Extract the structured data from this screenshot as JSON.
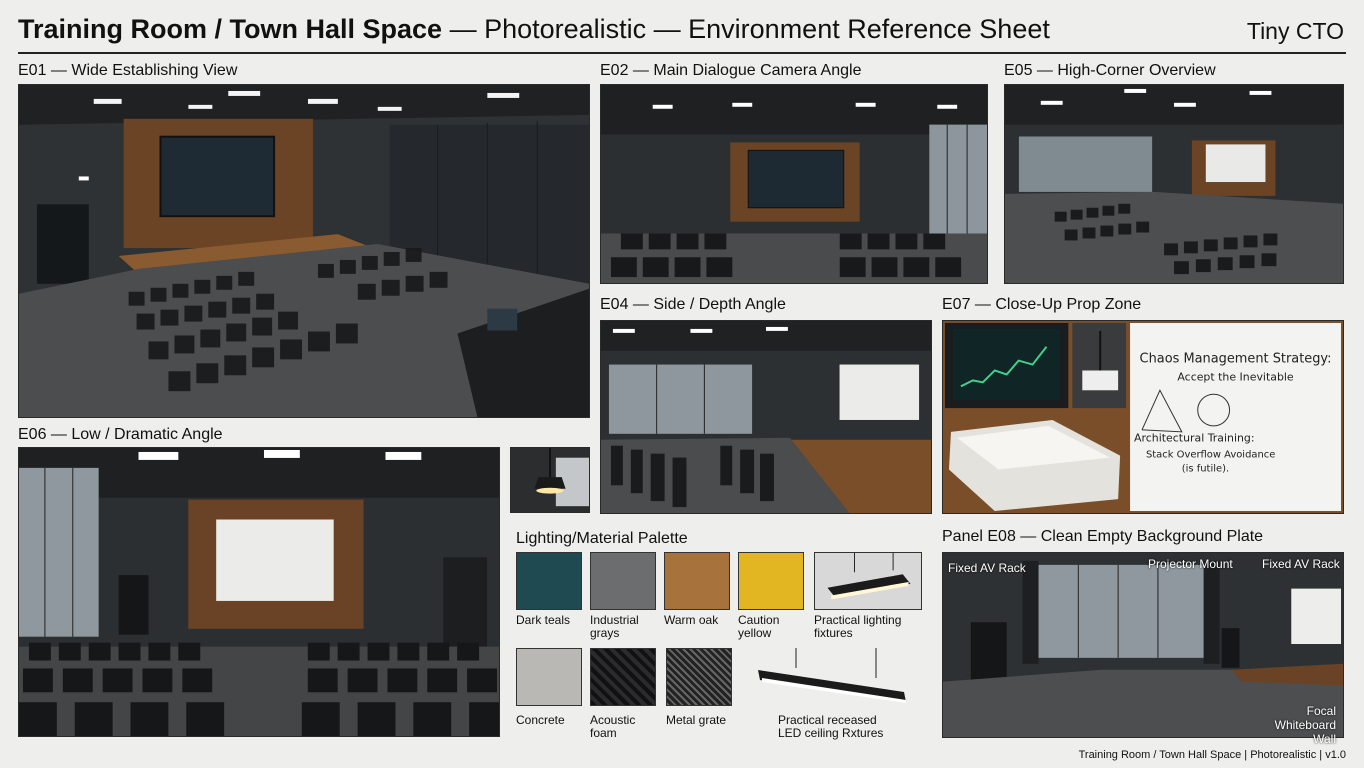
{
  "header": {
    "title_bold": "Training Room / Town Hall Space",
    "title_rest": " — Photorealistic — Environment Reference Sheet",
    "brand": "Tiny CTO"
  },
  "panels": {
    "e01": "E01 — Wide Establishing View",
    "e02": "E02 — Main Dialogue Camera Angle",
    "e05": "E05 — High-Corner Overview",
    "e04": "E04 — Side / Depth Angle",
    "e07": "E07 — Close-Up Prop Zone",
    "e06": "E06 — Low / Dramatic Angle",
    "e08": "Panel E08 — Clean Empty Background Plate"
  },
  "e07_props": {
    "whiteboard_title": "Chaos Management Strategy:",
    "whiteboard_sub": "Accept the Inevitable",
    "whiteboard_line2": "Architectural Training:",
    "whiteboard_line3": "Stack Overflow Avoidance",
    "whiteboard_line4": "(is futile)."
  },
  "palette": {
    "title": "Lighting/Material Palette",
    "swatches": [
      {
        "label": "Dark teals",
        "color": "#1f4a52"
      },
      {
        "label": "Industrial grays",
        "color": "#6b6d6e"
      },
      {
        "label": "Warm oak",
        "color": "#a8723d"
      },
      {
        "label": "Caution yellow",
        "color": "#e2b622"
      },
      {
        "label": "Practical lighting fixtures",
        "color": "#d8d8d8"
      },
      {
        "label": "Concrete",
        "color": "#b9b8b4"
      },
      {
        "label": "Acoustic foam",
        "color": "#1d1d1f"
      },
      {
        "label": "Metal grate",
        "color": "#3a3b3d"
      },
      {
        "label": "Practical receased LED ceiling Rxtures",
        "color": "#e8e8e8"
      }
    ]
  },
  "e08_annotations": {
    "left_rack": "Fixed AV Rack",
    "projector": "Projector Mount",
    "right_rack": "Fixed AV Rack",
    "whiteboard": "Focal\nWhiteboard Wall"
  },
  "footer": "Training Room / Town Hall Space | Photorealistic | v1.0"
}
